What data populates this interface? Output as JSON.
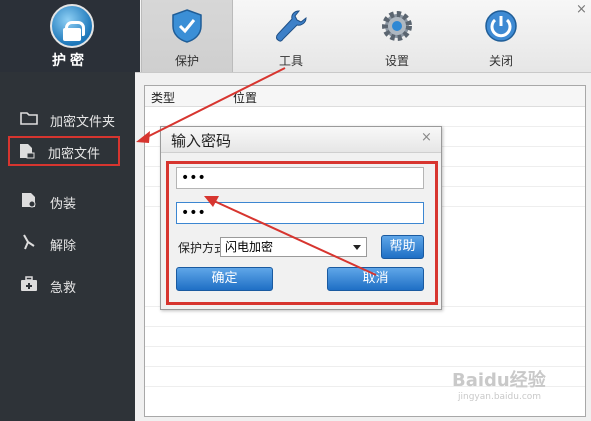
{
  "app": {
    "name": "护密"
  },
  "toolbar": {
    "tabs": [
      {
        "label": "保护",
        "icon": "shield-icon",
        "active": true
      },
      {
        "label": "工具",
        "icon": "wrench-icon",
        "active": false
      },
      {
        "label": "设置",
        "icon": "gear-icon",
        "active": false
      },
      {
        "label": "关闭",
        "icon": "power-icon",
        "active": false
      }
    ],
    "close_glyph": "×"
  },
  "sidebar": {
    "items": [
      {
        "label": "加密文件夹",
        "icon": "folder-icon"
      },
      {
        "label": "加密文件",
        "icon": "file-lock-icon",
        "highlighted": true
      },
      {
        "label": "伪装",
        "icon": "disguise-icon"
      },
      {
        "label": "解除",
        "icon": "unlock-icon"
      },
      {
        "label": "急救",
        "icon": "first-aid-icon"
      }
    ]
  },
  "main": {
    "columns": [
      "类型",
      "位置"
    ]
  },
  "dialog": {
    "title": "输入密码",
    "close_glyph": "×",
    "password": "•••",
    "confirm_password": "•••",
    "method_label": "保护方式",
    "method_value": "闪电加密",
    "help_label": "帮助",
    "ok_label": "确定",
    "cancel_label": "取消"
  },
  "watermark": {
    "text": "Baidu经验",
    "sub": "jingyan.baidu.com"
  },
  "colors": {
    "annotation_red": "#d7352f",
    "button_blue": "#1f6fc5",
    "sidebar_bg": "#2e3338"
  }
}
